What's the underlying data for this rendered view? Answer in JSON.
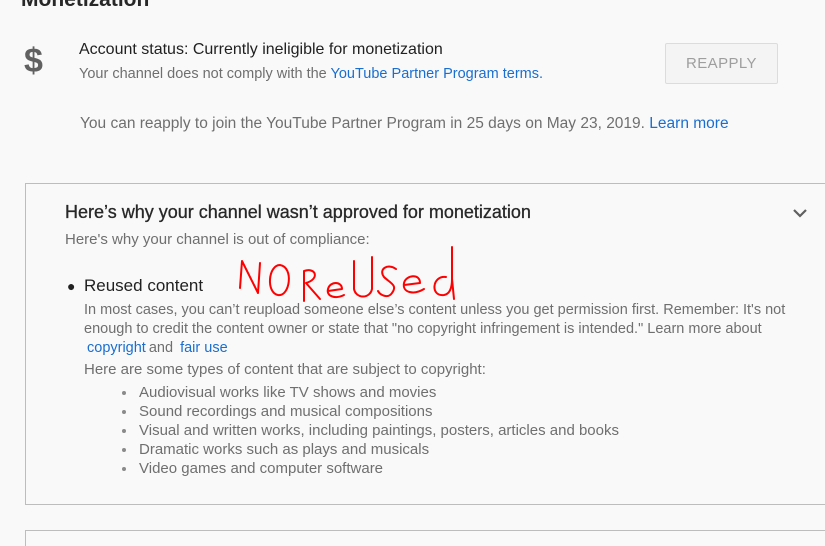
{
  "section": {
    "title": "Monetization"
  },
  "status": {
    "title": "Account status: Currently ineligible for monetization",
    "sub_prefix": "Your channel does not comply with the",
    "sub_link": "YouTube Partner Program terms."
  },
  "reapply": {
    "button_label": "REAPPLY",
    "note": "You can reapply to join the YouTube Partner Program in 25 days on May 23, 2019.",
    "learn_more": "Learn more"
  },
  "reason_card": {
    "heading": "Here’s why your channel wasn’t approved for monetization",
    "subheading": "Here's why your channel is out of compliance:",
    "reason": {
      "title": "Reused content",
      "body_1": "In most cases, you can’t reupload someone else’s content unless you get permission first. Remember: It's not enough to credit the content owner or state that \"no copyright infringement is intended.\" Learn more about",
      "link_copyright": "copyright",
      "and": "and",
      "link_fair_use": "fair use",
      "types_intro": "Here are some types of content that are subject to copyright:",
      "types": [
        "Audiovisual works like TV shows and movies",
        "Sound recordings and musical compositions",
        "Visual and written works, including paintings, posters, articles and books",
        "Dramatic works such as plays and musicals",
        "Video games and computer software"
      ]
    }
  },
  "annotation": {
    "text": "NO ReUSED",
    "color": "#ff0000"
  },
  "colors": {
    "link": "#1a6ed0",
    "muted_text": "#6f6f6f",
    "background": "#f9f9f9"
  }
}
